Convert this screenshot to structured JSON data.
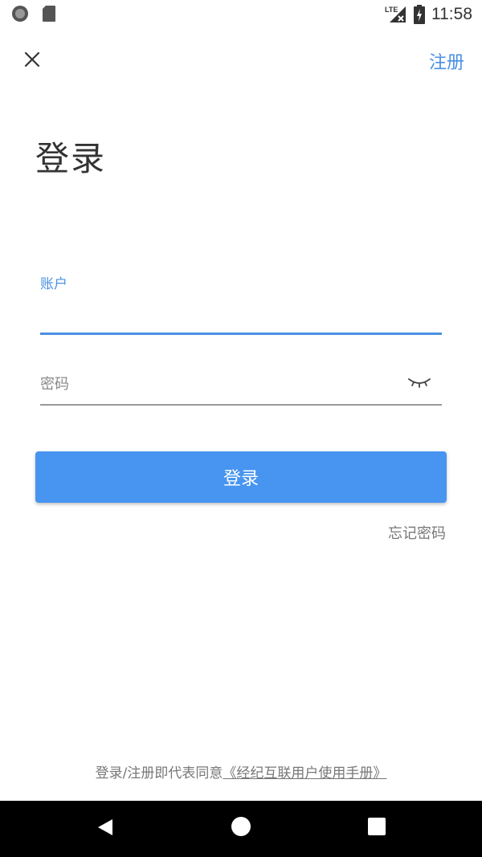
{
  "status_bar": {
    "time": "11:58",
    "network_label": "LTE",
    "icons": [
      "circle-status-icon",
      "sd-card-icon",
      "lte-signal-icon",
      "battery-icon"
    ]
  },
  "header": {
    "close_icon": "close-icon",
    "register_label": "注册"
  },
  "page": {
    "title": "登录"
  },
  "form": {
    "account": {
      "label": "账户",
      "value": ""
    },
    "password": {
      "placeholder": "密码",
      "value": "",
      "toggle_icon": "eye-closed-icon"
    },
    "login_label": "登录",
    "forgot_label": "忘记密码"
  },
  "footer": {
    "agreement_prefix": "登录/注册即代表同意",
    "agreement_link": "《经纪互联用户使用手册》"
  },
  "nav_bar": {
    "icons": [
      "back-triangle-icon",
      "home-circle-icon",
      "recents-square-icon"
    ]
  },
  "colors": {
    "accent": "#4a90e2",
    "button": "#4895f1",
    "text_primary": "#333333",
    "text_secondary": "#777777",
    "nav_bar": "#000000"
  }
}
